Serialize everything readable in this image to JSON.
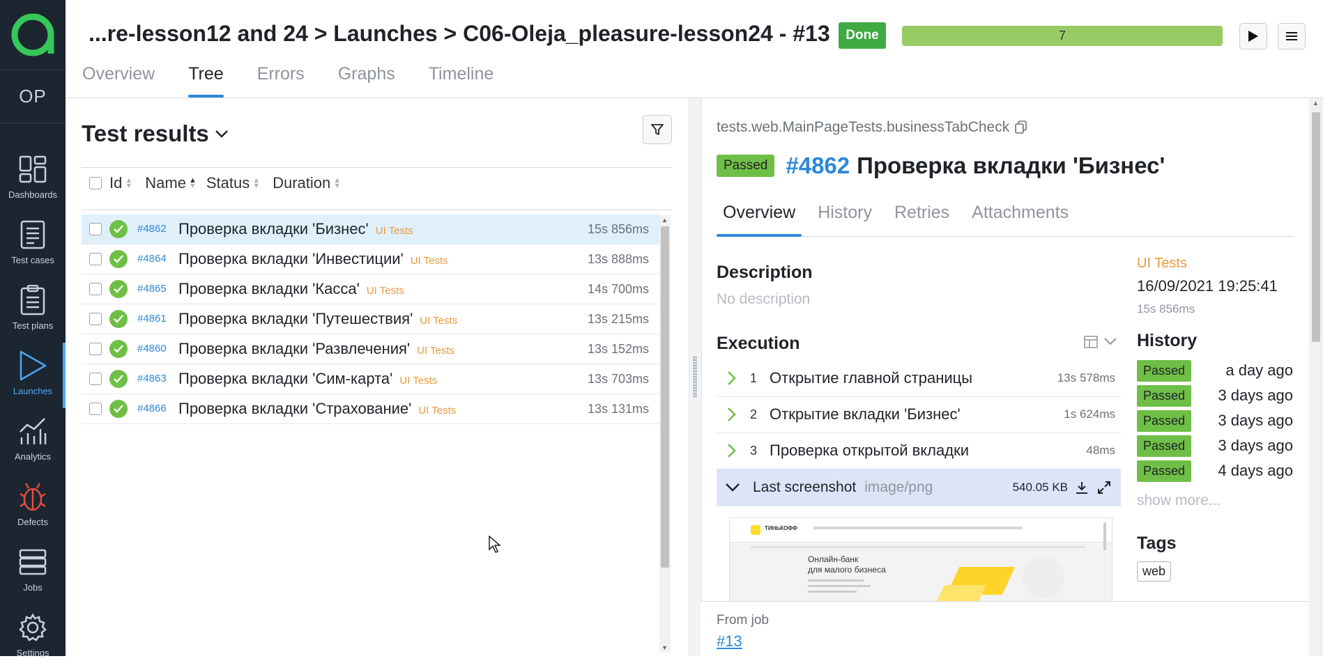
{
  "sidebar": {
    "logo": "a",
    "project_initials": "OP",
    "items": [
      {
        "label": "Dashboards",
        "icon": "dashboards-icon"
      },
      {
        "label": "Test cases",
        "icon": "test-cases-icon"
      },
      {
        "label": "Test plans",
        "icon": "test-plans-icon"
      },
      {
        "label": "Launches",
        "icon": "launches-icon",
        "active": true
      },
      {
        "label": "Analytics",
        "icon": "analytics-icon"
      },
      {
        "label": "Defects",
        "icon": "defects-icon"
      },
      {
        "label": "Jobs",
        "icon": "jobs-icon"
      },
      {
        "label": "Settings",
        "icon": "settings-icon"
      }
    ]
  },
  "header": {
    "breadcrumb": "...re-lesson12 and 24 > Launches > C06-Oleja_pleasure-lesson24 - #13",
    "status": "Done",
    "progress_value": "7",
    "tabs": [
      "Overview",
      "Tree",
      "Errors",
      "Graphs",
      "Timeline"
    ],
    "active_tab": "Tree"
  },
  "tree": {
    "title": "Test results",
    "columns": {
      "id": "Id",
      "name": "Name",
      "status": "Status",
      "duration": "Duration"
    },
    "rows": [
      {
        "id": "#4862",
        "name": "Проверка вкладки 'Бизнес'",
        "tag": "UI Tests",
        "duration": "15s 856ms"
      },
      {
        "id": "#4864",
        "name": "Проверка вкладки 'Инвестиции'",
        "tag": "UI Tests",
        "duration": "13s 888ms"
      },
      {
        "id": "#4865",
        "name": "Проверка вкладки 'Касса'",
        "tag": "UI Tests",
        "duration": "14s 700ms"
      },
      {
        "id": "#4861",
        "name": "Проверка вкладки 'Путешествия'",
        "tag": "UI Tests",
        "duration": "13s 215ms"
      },
      {
        "id": "#4860",
        "name": "Проверка вкладки 'Развлечения'",
        "tag": "UI Tests",
        "duration": "13s 152ms"
      },
      {
        "id": "#4863",
        "name": "Проверка вкладки 'Сим-карта'",
        "tag": "UI Tests",
        "duration": "13s 703ms"
      },
      {
        "id": "#4866",
        "name": "Проверка вкладки 'Страхование'",
        "tag": "UI Tests",
        "duration": "13s 131ms"
      }
    ]
  },
  "detail": {
    "test_path": "tests.web.MainPageTests.businessTabCheck",
    "status": "Passed",
    "id": "#4862",
    "name": "Проверка вкладки 'Бизнес'",
    "tabs": [
      "Overview",
      "History",
      "Retries",
      "Attachments"
    ],
    "description_heading": "Description",
    "description": "No description",
    "execution_heading": "Execution",
    "steps": [
      {
        "n": "1",
        "name": "Открытие главной страницы",
        "duration": "13s 578ms"
      },
      {
        "n": "2",
        "name": "Открытие вкладки 'Бизнес'",
        "duration": "1s 624ms"
      },
      {
        "n": "3",
        "name": "Проверка открытой вкладки",
        "duration": "48ms"
      }
    ],
    "attachment": {
      "name": "Last screenshot",
      "type": "image/png",
      "size": "540.05 KB"
    },
    "screenshot": {
      "heading": "Онлайн-банк\nдля малого бизнеса",
      "brand": "ТИНЬКОФФ"
    },
    "suite": "UI Tests",
    "date": "16/09/2021 19:25:41",
    "duration": "15s 856ms",
    "history_heading": "History",
    "history": [
      {
        "status": "Passed",
        "ago": "a day ago"
      },
      {
        "status": "Passed",
        "ago": "3 days ago"
      },
      {
        "status": "Passed",
        "ago": "3 days ago"
      },
      {
        "status": "Passed",
        "ago": "3 days ago"
      },
      {
        "status": "Passed",
        "ago": "4 days ago"
      }
    ],
    "show_more": "show more...",
    "tags_heading": "Tags",
    "tags": [
      "web"
    ],
    "from_job_label": "From job",
    "from_job_link": "#13"
  }
}
